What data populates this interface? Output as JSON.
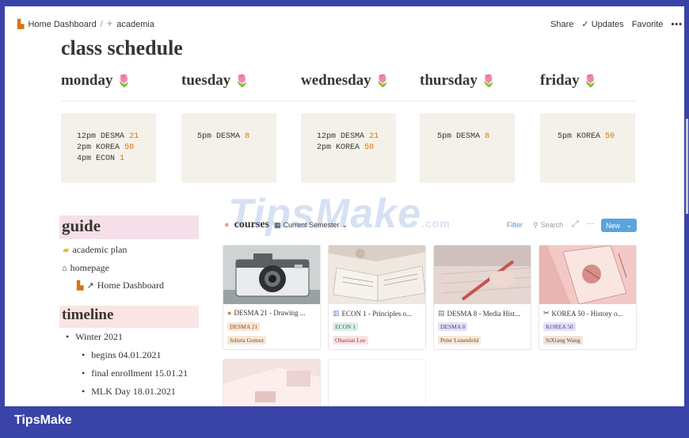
{
  "topbar": {
    "crumb1": "Home Dashboard",
    "crumb_sep": "/",
    "crumb2": "academia",
    "share": "Share",
    "updates": "Updates",
    "favorite": "Favorite",
    "more": "•••"
  },
  "page_title": "class schedule",
  "days": [
    "monday",
    "tuesday",
    "wednesday",
    "thursday",
    "friday"
  ],
  "schedule": {
    "monday": [
      {
        "time": "12pm",
        "course": "DESMA",
        "num": "21"
      },
      {
        "time": "2pm",
        "course": "KOREA",
        "num": "50"
      },
      {
        "time": "4pm",
        "course": "ECON",
        "num": "1"
      }
    ],
    "tuesday": [
      {
        "time": "5pm",
        "course": "DESMA",
        "num": "8"
      }
    ],
    "wednesday": [
      {
        "time": "12pm",
        "course": "DESMA",
        "num": "21"
      },
      {
        "time": "2pm",
        "course": "KOREA",
        "num": "50"
      }
    ],
    "thursday": [
      {
        "time": "5pm",
        "course": "DESMA",
        "num": "8"
      }
    ],
    "friday": [
      {
        "time": "5pm",
        "course": "KOREA",
        "num": "50"
      }
    ]
  },
  "guide": {
    "heading": "guide",
    "items": [
      "academic plan",
      "homepage",
      "Home Dashboard"
    ]
  },
  "timeline": {
    "heading": "timeline",
    "items": [
      {
        "text": "Winter 2021",
        "level": 0
      },
      {
        "text": "begins 04.01.2021",
        "level": 1
      },
      {
        "text": "final enrollment 15.01.21",
        "level": 1
      },
      {
        "text": "MLK Day 18.01.2021",
        "level": 1
      }
    ]
  },
  "courses": {
    "title": "courses",
    "view": "Current Semester",
    "filter": "Filter",
    "search": "Search",
    "new": "New",
    "cards": [
      {
        "title": "DESMA 21 - Drawing ...",
        "tag1": "DESMA 21",
        "tag2": "Julieta Gomez"
      },
      {
        "title": "ECON 1 - Principles o...",
        "tag1": "ECON 1",
        "tag2": "Ohanian Lee"
      },
      {
        "title": "DESMA 8 - Media Hist...",
        "tag1": "DESMA 8",
        "tag2": "Peter Lunenfeld"
      },
      {
        "title": "KOREA 50 - History o...",
        "tag1": "KOREA 50",
        "tag2": "SiXiang Wang"
      }
    ]
  },
  "watermark": {
    "text": "TipsMake",
    "suffix": ".com"
  },
  "brand": "TipsMake",
  "colors": {
    "frame": "#3a44a8",
    "course_number": "#d9730d",
    "card_bg": "#f4f1ea",
    "new_button": "#5aa5dd"
  }
}
